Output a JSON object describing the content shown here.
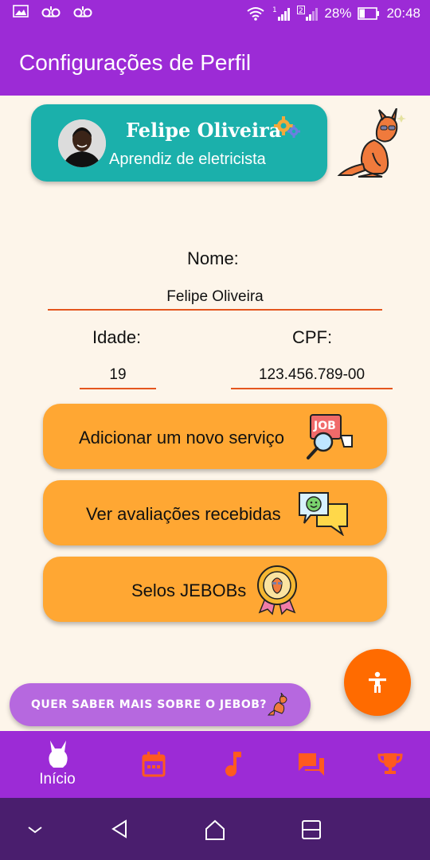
{
  "status_bar": {
    "battery": "28%",
    "time": "20:48"
  },
  "app_bar": {
    "title": "Configurações de Perfil"
  },
  "profile": {
    "name": "Felipe Oliveira",
    "role": "Aprendiz de eletricista"
  },
  "form": {
    "name_label": "Nome:",
    "name_value": "Felipe Oliveira",
    "age_label": "Idade:",
    "age_value": "19",
    "cpf_label": "CPF:",
    "cpf_value": "123.456.789-00"
  },
  "actions": [
    {
      "label": "Adicionar um novo serviço",
      "icon": "job-search-icon"
    },
    {
      "label": "Ver avaliações recebidas",
      "icon": "chat-reviews-icon"
    },
    {
      "label": "Selos JEBOBs",
      "icon": "badge-medal-icon"
    }
  ],
  "promo": {
    "text": "QUER SABER MAIS SOBRE O JEBOB?"
  },
  "bottom_nav": {
    "items": [
      {
        "label": "Início",
        "icon": "kangaroo-home-icon"
      },
      {
        "icon": "calendar-icon"
      },
      {
        "icon": "music-note-icon"
      },
      {
        "icon": "chat-icon"
      },
      {
        "icon": "trophy-icon"
      }
    ]
  },
  "colors": {
    "primary": "#9C2BD6",
    "teal": "#1BB0AB",
    "orange_button": "#FFA733",
    "fab": "#FF6B00",
    "nav_icon": "#FF5A1F",
    "background": "#FDF5EA"
  }
}
